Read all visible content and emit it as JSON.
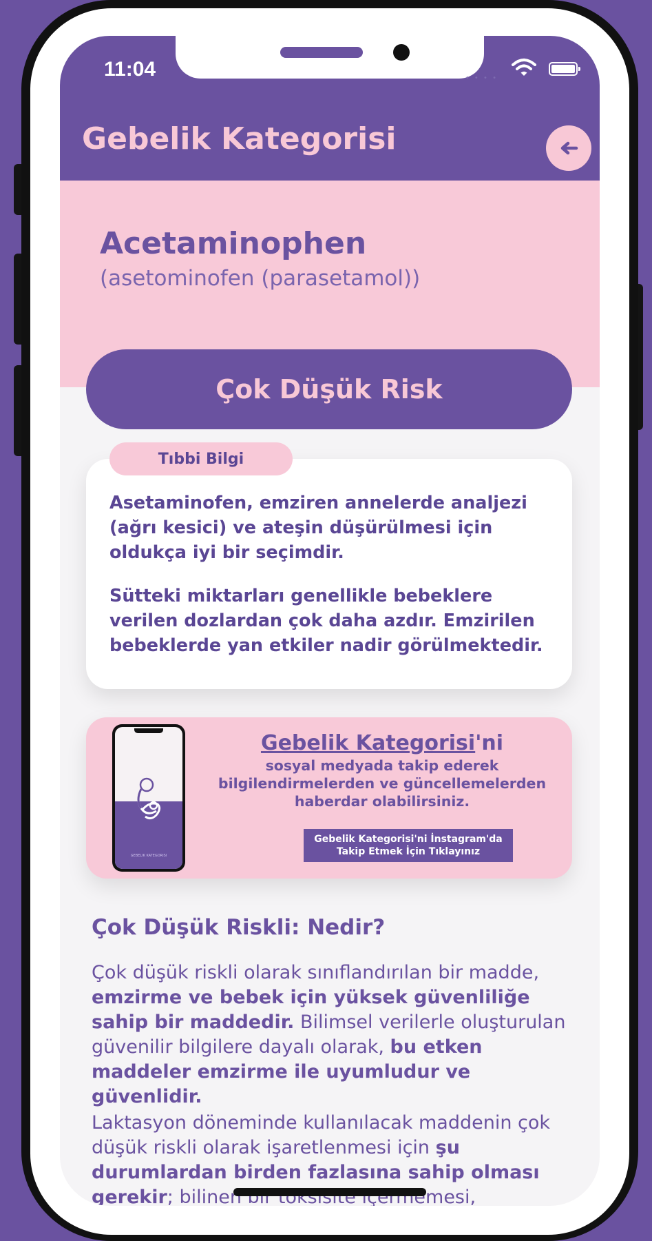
{
  "status_bar": {
    "time": "11:04"
  },
  "header": {
    "title": "Gebelik Kategorisi",
    "back_icon": "arrow-left-icon"
  },
  "drug": {
    "name": "Acetaminophen",
    "subtitle": "(asetominofen (parasetamol))"
  },
  "risk": {
    "label": "Çok Düşük Risk"
  },
  "info_card": {
    "tab_label": "Tıbbi Bilgi",
    "paragraph_1": "Asetaminofen, emziren annelerde analjezi (ağrı kesici) ve ateşin düşürülmesi için oldukça iyi bir seçimdir.",
    "paragraph_2": "Sütteki miktarları genellikle bebeklere verilen dozlardan çok daha azdır. Emzirilen bebeklerde yan etkiler nadir görülmektedir."
  },
  "promo": {
    "brand": "Gebelik Kategorisi",
    "brand_suffix": "'ni",
    "body": "sosyal medyada takip ederek bilgilendirmelerden ve güncellemelerden haberdar olabilirsiniz.",
    "button_line_1": "Gebelik Kategorisi'ni İnstagram'da",
    "button_line_2": "Takip Etmek İçin Tıklayınız",
    "mini_phone_caption": "GEBELIK KATEGORISI"
  },
  "article": {
    "title": "Çok Düşük Riskli: Nedir?",
    "p1_a": "Çok düşük riskli olarak sınıflandırılan bir madde, ",
    "p1_b": "emzirme ve bebek için yüksek güvenliliğe sahip bir maddedir.",
    "p1_c": " Bilimsel verilerle oluşturulan güvenilir bilgilere dayalı olarak, ",
    "p1_d": "bu etken maddeler emzirme ile uyumludur ve güvenlidir.",
    "p2_a": "Laktasyon döneminde kullanılacak maddenin çok düşük riskli olarak işaretlenmesi için ",
    "p2_b": "şu durumlardan birden fazlasına sahip olması gerekir",
    "p2_c": "; bilinen bir toksisite içermemesi,"
  },
  "colors": {
    "purple": "#6a52a0",
    "pink": "#f8c9d8",
    "card_white": "#ffffff",
    "screen_bg": "#f5f4f6"
  }
}
